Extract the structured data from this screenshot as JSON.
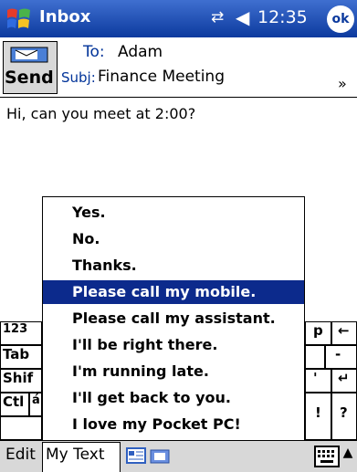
{
  "titlebar": {
    "title": "Inbox",
    "time": "12:35",
    "ok_label": "ok",
    "connectivity_icon": "connectivity-icon",
    "volume_icon": "speaker-icon",
    "start_icon": "windows-flag-icon"
  },
  "header": {
    "send_label": "Send",
    "to_label": "To:",
    "to_value": "Adam",
    "subj_label": "Subj:",
    "subj_value": "Finance Meeting",
    "expand_glyph": "»"
  },
  "body_text": "Hi, can you meet at 2:00?",
  "keyboard": {
    "left_keys": [
      "123",
      "Tab",
      "Shif",
      "Ctl",
      "á"
    ],
    "right_keys": [
      "p",
      "←",
      "-",
      "'",
      "↵",
      "!",
      "?"
    ]
  },
  "mytext_list": {
    "selected_index": 3,
    "items": [
      "Yes.",
      "No.",
      "Thanks.",
      "Please call my mobile.",
      "Please call my assistant.",
      "I'll be right there.",
      "I'm running late.",
      "I'll get back to you.",
      "I love my Pocket PC!"
    ]
  },
  "menubar": {
    "edit_label": "Edit",
    "mytext_label": "My Text",
    "icons": [
      "contact-card-icon",
      "attachment-icon",
      "keyboard-icon",
      "sip-up-arrow-icon"
    ],
    "sip_arrow": "▲"
  }
}
